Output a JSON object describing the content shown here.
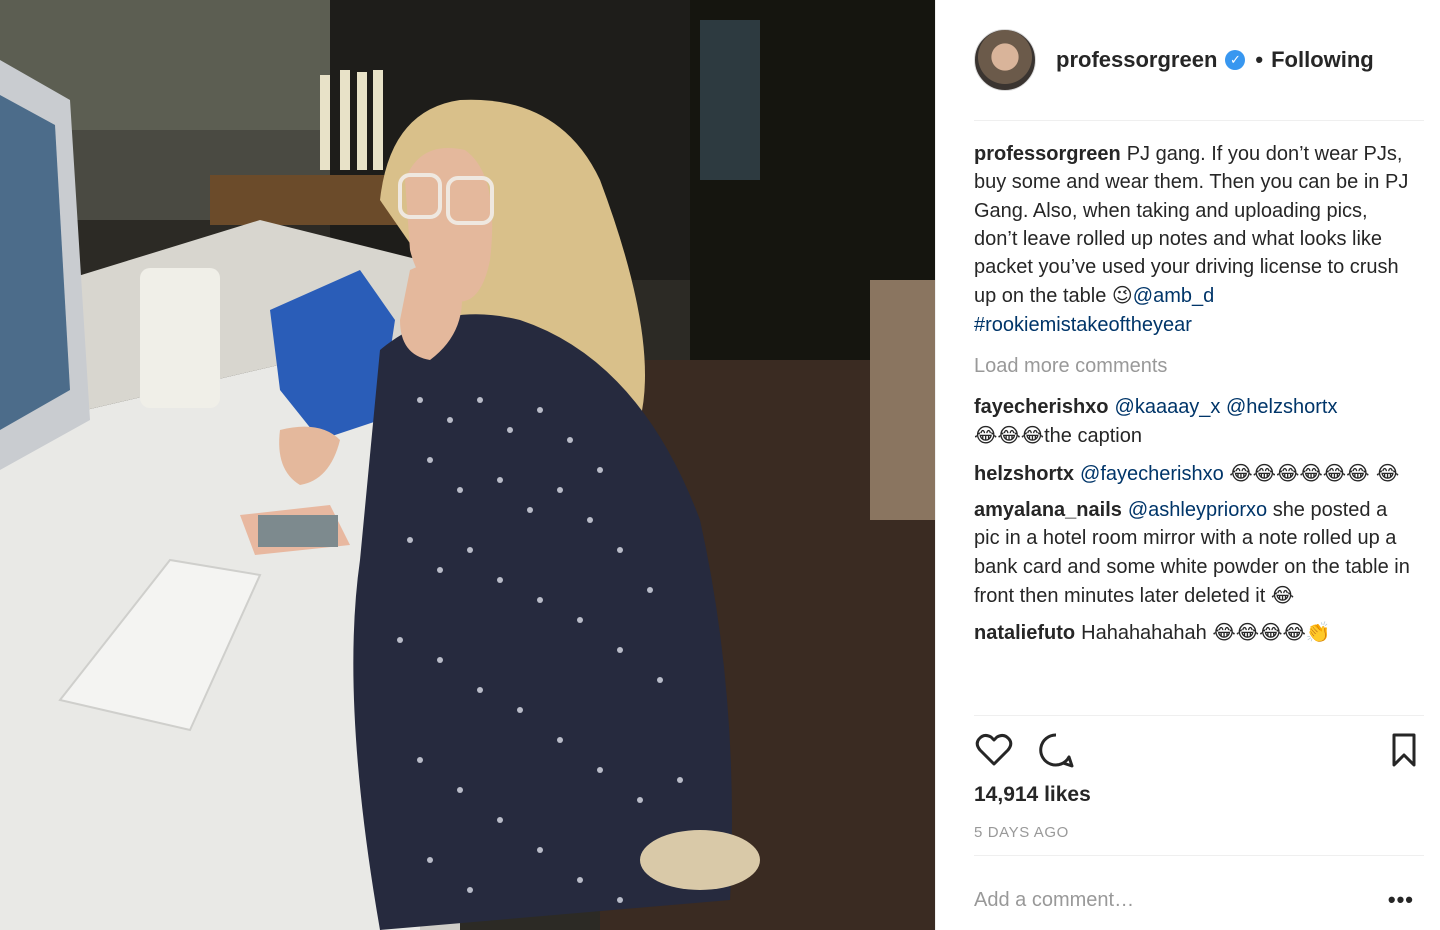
{
  "post": {
    "photo_alt": "Woman in polka-dot pyjamas at a kitchen desk",
    "colors": {
      "accent_link": "#003569",
      "muted": "#999999",
      "verified": "#3897f0"
    }
  },
  "header": {
    "username": "professorgreen",
    "verified_icon": "check-icon",
    "separator": "•",
    "follow_state": "Following"
  },
  "caption": {
    "user": "professorgreen",
    "text": "PJ gang. If you don’t wear PJs, buy some and wear them. Then you can be in PJ Gang. Also, when taking and uploading pics, don’t leave rolled up notes and what looks like packet you’ve used your driving license to crush up on the table",
    "emoji": "😉",
    "mention": "@amb_d",
    "hashtag": "#rookiemistakeoftheyear"
  },
  "load_more": "Load more comments",
  "comments": [
    {
      "user": "fayecherishxo",
      "mentions": "@kaaaay_x @helzshortx",
      "emoji": "😂😂😂",
      "text": "the caption"
    },
    {
      "user": "helzshortx",
      "mentions": "@fayecherishxo",
      "emoji": "😂😂😂😂😂😂 😂",
      "text": ""
    },
    {
      "user": "amyalana_nails",
      "mentions": "@ashleypriorxo",
      "text": "she posted a pic in a hotel room mirror with a note rolled up a bank card and some white powder on the table in front then minutes later deleted it",
      "emoji": "😂"
    },
    {
      "user": "nataliefuto",
      "mentions": "",
      "text": "Hahahahahah",
      "emoji": "😂😂😂😂👏"
    }
  ],
  "actions": {
    "like_icon": "heart-icon",
    "comment_icon": "comment-bubble-icon",
    "save_icon": "bookmark-icon"
  },
  "likes": "14,914 likes",
  "timestamp": "5 DAYS AGO",
  "add_comment": {
    "placeholder": "Add a comment…",
    "more": "•••"
  }
}
